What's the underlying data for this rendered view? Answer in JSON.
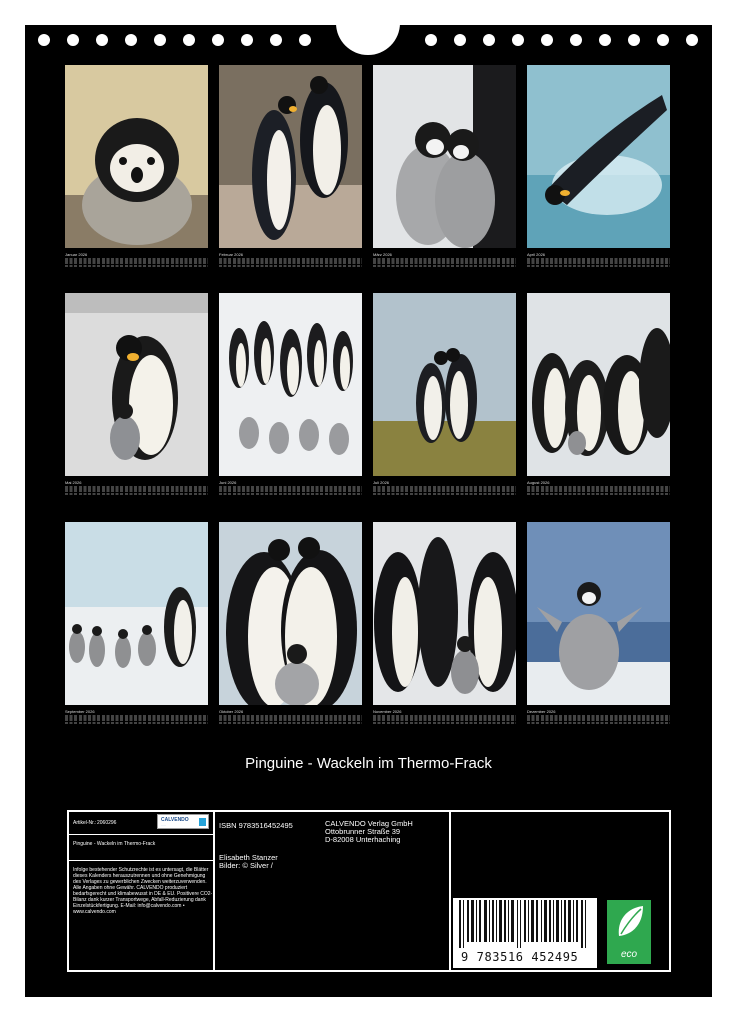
{
  "months": [
    {
      "label": "Januar 2026"
    },
    {
      "label": "Februar 2026"
    },
    {
      "label": "März 2026"
    },
    {
      "label": "April 2026"
    },
    {
      "label": "Mai 2026"
    },
    {
      "label": "Juni 2026"
    },
    {
      "label": "Juli 2026"
    },
    {
      "label": "August 2026"
    },
    {
      "label": "September 2026"
    },
    {
      "label": "Oktober 2026"
    },
    {
      "label": "November 2026"
    },
    {
      "label": "Dezember 2026"
    }
  ],
  "title": "Pinguine - Wackeln im Thermo-Frack",
  "info": {
    "article_label": "Artikel-Nr.:",
    "article_number": "2060296",
    "brand_name": "CALVENDO",
    "product_title": "Pinguine - Wackeln im Thermo-Frack",
    "legal": "Infolge bestehender Schutzrechte ist es untersagt, die Blätter dieses Kalenders herauszutrennen und ohne Genehmigung des Verlages zu gewerblichen Zwecken weiterzuverwenden. Alle Angaben ohne Gewähr. CALVENDO produziert bedarfsgerecht und klimabewusst in DE & EU. Positivere CO2-Bilanz dank kurzer Transportwege, Abfall-Reduzierung dank Einzelstückfertigung. E-Mail: info@calvendo.com • www.calvendo.com",
    "isbn": "ISBN 9783516452495",
    "publisher_lines": [
      "CALVENDO Verlag GmbH",
      "Ottobrunner Straße 39",
      "D-82008 Unterhaching"
    ],
    "author": "Elisabeth Stanzer",
    "credits": "Bilder: © Silver /",
    "barcode_digits": "9 783516 452495",
    "eco_label": "eco"
  },
  "colors": {
    "page_background": "#000000",
    "eco_green": "#2fa84f",
    "brand_blue": "#25a2d8"
  }
}
